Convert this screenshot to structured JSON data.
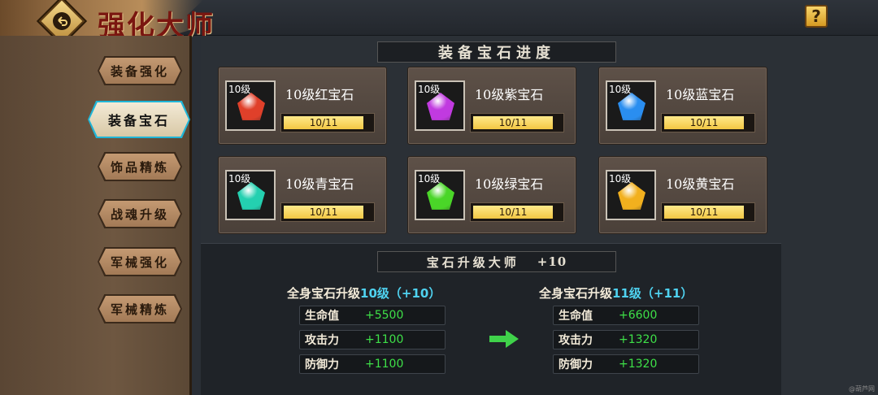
{
  "header": {
    "title": "强化大师",
    "help_label": "?"
  },
  "sidebar": {
    "items": [
      {
        "label": "装备强化",
        "active": false
      },
      {
        "label": "装备宝石",
        "active": true
      },
      {
        "label": "饰品精炼",
        "active": false
      },
      {
        "label": "战魂升级",
        "active": false
      },
      {
        "label": "军械强化",
        "active": false
      },
      {
        "label": "军械精炼",
        "active": false
      }
    ]
  },
  "progress": {
    "title": "装备宝石进度",
    "gems": [
      {
        "level_tag": "10级",
        "name": "10级红宝石",
        "progress": "10/11",
        "fraction": 0.909,
        "color": "#e0402a",
        "icon": "red-gem-icon"
      },
      {
        "level_tag": "10级",
        "name": "10级紫宝石",
        "progress": "10/11",
        "fraction": 0.909,
        "color": "#c13ae0",
        "icon": "purple-gem-icon"
      },
      {
        "level_tag": "10级",
        "name": "10级蓝宝石",
        "progress": "10/11",
        "fraction": 0.909,
        "color": "#2a8ef0",
        "icon": "blue-gem-icon"
      },
      {
        "level_tag": "10级",
        "name": "10级青宝石",
        "progress": "10/11",
        "fraction": 0.909,
        "color": "#24d0b0",
        "icon": "cyan-gem-icon"
      },
      {
        "level_tag": "10级",
        "name": "10级绿宝石",
        "progress": "10/11",
        "fraction": 0.909,
        "color": "#4ad628",
        "icon": "green-gem-icon"
      },
      {
        "level_tag": "10级",
        "name": "10级黄宝石",
        "progress": "10/11",
        "fraction": 0.909,
        "color": "#f2b01e",
        "icon": "yellow-gem-icon"
      }
    ]
  },
  "master": {
    "title": "宝石升级大师",
    "bonus": "+10",
    "current": {
      "head_prefix": "全身宝石升级",
      "head_level": "10级",
      "head_bonus": "（+10）",
      "stats": [
        {
          "label": "生命值",
          "value": "+5500"
        },
        {
          "label": "攻击力",
          "value": "+1100"
        },
        {
          "label": "防御力",
          "value": "+1100"
        }
      ]
    },
    "next": {
      "head_prefix": "全身宝石升级",
      "head_level": "11级",
      "head_bonus": "（+11）",
      "stats": [
        {
          "label": "生命值",
          "value": "+6600"
        },
        {
          "label": "攻击力",
          "value": "+1320"
        },
        {
          "label": "防御力",
          "value": "+1320"
        }
      ]
    },
    "arrow_icon": "right-arrow-icon"
  },
  "corner_note": "@葫芦网"
}
